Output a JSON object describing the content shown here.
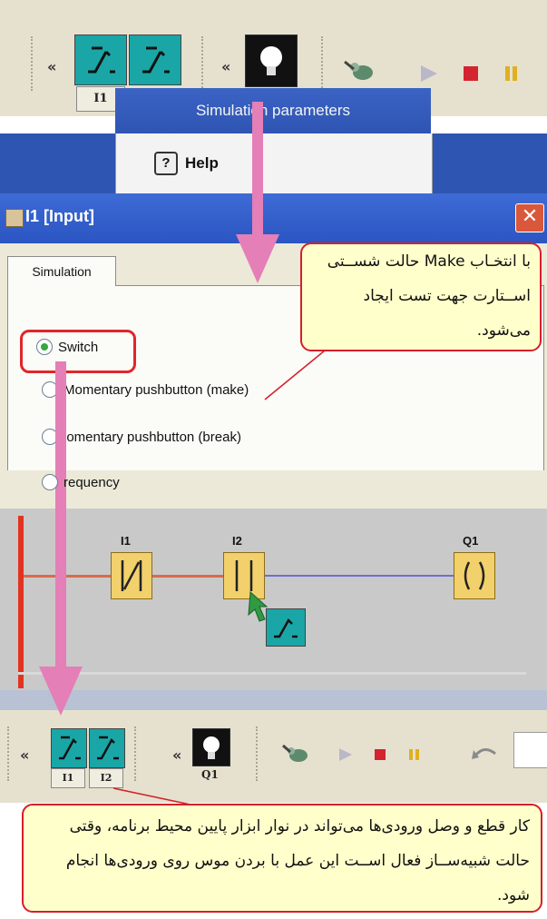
{
  "toolbar": {
    "collapse_glyph": "«",
    "input_label": "I1",
    "input_labels": [
      "I1",
      "I2"
    ],
    "output_label": "Q1"
  },
  "menu": {
    "simulation_parameters": "Simulation parameters",
    "help": "Help"
  },
  "dialog": {
    "title": "I1 [Input]",
    "close_glyph": "✕",
    "tab": "Simulation",
    "options": [
      {
        "label": "Switch",
        "selected": true
      },
      {
        "label": "Momentary pushbutton (make)",
        "selected": false
      },
      {
        "label": "lomentary pushbutton (break)",
        "selected": false
      },
      {
        "label": "requency",
        "selected": false
      }
    ]
  },
  "ladder": {
    "contacts": [
      {
        "name": "I1",
        "symbol": "-|/|-"
      },
      {
        "name": "I2",
        "symbol": "-| |-"
      }
    ],
    "coil": {
      "name": "Q1",
      "symbol": "( )"
    }
  },
  "callouts": {
    "top": "با انتخـاب Make حالت شســتی اســتارت جهت تست ایجاد می‌شود.",
    "bottom": "کار قطع و وصل ورودی‌ها می‌تواند در نوار ابزار پایین محیط برنامه، وقتی حالت شبیه‌ســاز فعال اســت این عمل با بردن موس روی ورودی‌ها انجام شود."
  },
  "colors": {
    "toolbar_bg": "#e6e1cf",
    "menu_highlight": "#2f55b3",
    "dialog_title": "#2a55c2",
    "arrow": "#e47fb7",
    "callout_bg": "#ffffcc",
    "callout_border": "#d4202b",
    "contact": "#f2d06b",
    "input_tile": "#1aa6a6"
  }
}
